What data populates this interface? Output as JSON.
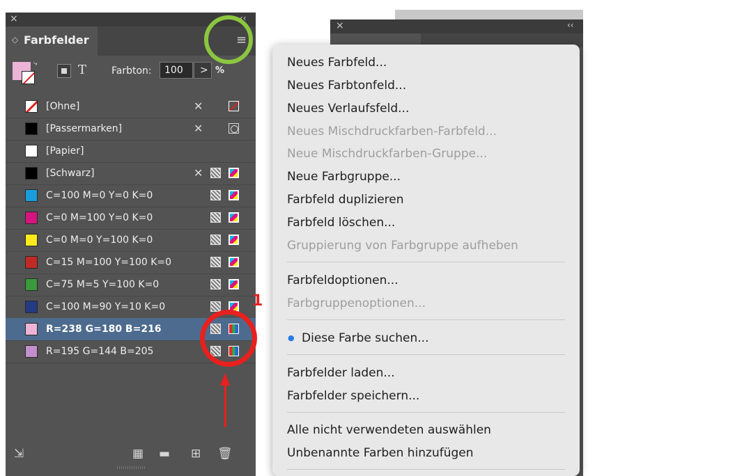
{
  "panel": {
    "close_glyph": "×",
    "collapse_glyph": "‹‹",
    "title_arrows": "◇",
    "title": "Farbfelder",
    "menu_glyph": "≡",
    "fill_stroke_swap_glyph": "⤷",
    "text_tool_glyph": "T",
    "tint_label": "Farbton:",
    "tint_value": "100",
    "tint_arrow": ">",
    "tint_unit": "%",
    "swatches": [
      {
        "name": "[Ohne]",
        "color": "#ffffff",
        "kind": "none",
        "edit_icon": "✕",
        "type_icon": "none"
      },
      {
        "name": "[Passermarken]",
        "color": "#000000",
        "kind": "solid",
        "edit_icon": "✕",
        "type_icon": "registration"
      },
      {
        "name": "[Papier]",
        "color": "#ffffff",
        "kind": "solid",
        "edit_icon": "",
        "type_icon": ""
      },
      {
        "name": "[Schwarz]",
        "color": "#000000",
        "kind": "solid",
        "edit_icon": "✕",
        "type_icon": "cmyk"
      },
      {
        "name": "C=100 M=0 Y=0 K=0",
        "color": "#1a9ddb",
        "kind": "solid",
        "edit_icon": "",
        "type_icon": "cmyk"
      },
      {
        "name": "C=0 M=100 Y=0 K=0",
        "color": "#d6137e",
        "kind": "solid",
        "edit_icon": "",
        "type_icon": "cmyk"
      },
      {
        "name": "C=0 M=0 Y=100 K=0",
        "color": "#fdeb1b",
        "kind": "solid",
        "edit_icon": "",
        "type_icon": "cmyk"
      },
      {
        "name": "C=15 M=100 Y=100 K=0",
        "color": "#c22a25",
        "kind": "solid",
        "edit_icon": "",
        "type_icon": "cmyk"
      },
      {
        "name": "C=75 M=5 Y=100 K=0",
        "color": "#3a9a3c",
        "kind": "solid",
        "edit_icon": "",
        "type_icon": "cmyk"
      },
      {
        "name": "C=100 M=90 Y=10 K=0",
        "color": "#243a82",
        "kind": "solid",
        "edit_icon": "",
        "type_icon": "cmyk"
      },
      {
        "name": "R=238 G=180 B=216",
        "color": "#eeb4d8",
        "kind": "solid",
        "edit_icon": "",
        "type_icon": "rgb",
        "selected": true
      },
      {
        "name": "R=195 G=144 B=205",
        "color": "#c390cd",
        "kind": "solid",
        "edit_icon": "",
        "type_icon": "rgb"
      }
    ],
    "footer_icons": [
      "import-swatch-icon",
      "view-options-icon",
      "folder-icon",
      "new-swatch-icon",
      "trash-icon"
    ],
    "footer_glyphs": [
      "⇲",
      "▦",
      "▬",
      "⊞",
      "🗑"
    ]
  },
  "panel2": {
    "close_glyph": "×",
    "collapse_glyph": "‹‹"
  },
  "annotation": {
    "number_label": "1",
    "green_circle_color": "#8cc63f",
    "red_color": "#e8201e"
  },
  "menu": {
    "items": [
      {
        "label": "Neues Farbfeld...",
        "enabled": true
      },
      {
        "label": "Neues Farbtonfeld...",
        "enabled": true
      },
      {
        "label": "Neues Verlaufsfeld...",
        "enabled": true
      },
      {
        "label": "Neues Mischdruckfarben-Farbfeld...",
        "enabled": false
      },
      {
        "label": "Neue Mischdruckfarben-Gruppe...",
        "enabled": false
      },
      {
        "label": "Neue Farbgruppe...",
        "enabled": true
      },
      {
        "label": "Farbfeld duplizieren",
        "enabled": true
      },
      {
        "label": "Farbfeld löschen...",
        "enabled": true
      },
      {
        "label": "Gruppierung von Farbgruppe aufheben",
        "enabled": false
      },
      {
        "label": "Farbfeldoptionen...",
        "enabled": true
      },
      {
        "label": "Farbgruppenoptionen...",
        "enabled": false
      },
      {
        "label": "Diese Farbe suchen...",
        "enabled": true,
        "bullet": "●"
      },
      {
        "label": "Farbfelder laden...",
        "enabled": true
      },
      {
        "label": "Farbfelder speichern...",
        "enabled": true
      },
      {
        "label": "Alle nicht verwendeten auswählen",
        "enabled": true
      },
      {
        "label": "Unbenannte Farben hinzufügen",
        "enabled": true
      }
    ]
  }
}
